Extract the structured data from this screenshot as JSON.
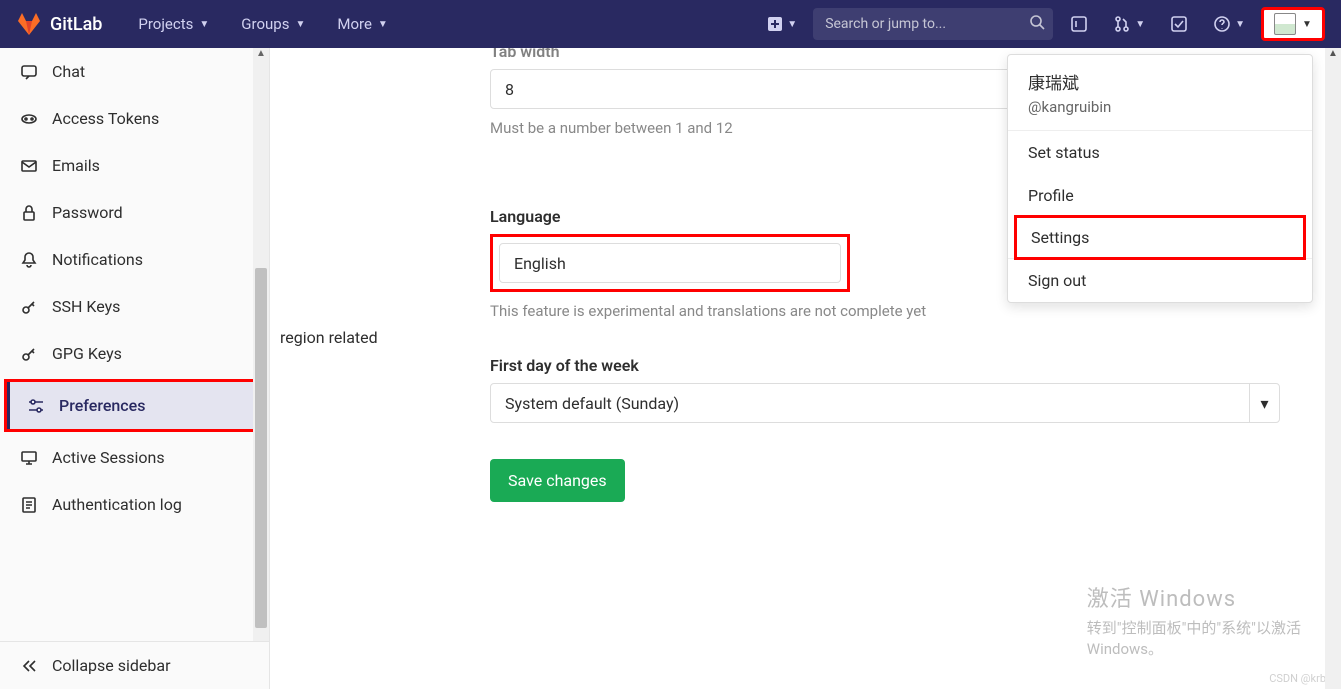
{
  "header": {
    "brand": "GitLab",
    "nav": {
      "projects": "Projects",
      "groups": "Groups",
      "more": "More"
    },
    "search_placeholder": "Search or jump to..."
  },
  "sidebar": {
    "items": [
      {
        "label": "Chat"
      },
      {
        "label": "Access Tokens"
      },
      {
        "label": "Emails"
      },
      {
        "label": "Password"
      },
      {
        "label": "Notifications"
      },
      {
        "label": "SSH Keys"
      },
      {
        "label": "GPG Keys"
      },
      {
        "label": "Preferences"
      },
      {
        "label": "Active Sessions"
      },
      {
        "label": "Authentication log"
      }
    ],
    "collapse": "Collapse sidebar"
  },
  "form": {
    "region_label": "region related",
    "tab_width": {
      "label": "Tab width",
      "value": "8",
      "hint": "Must be a number between 1 and 12"
    },
    "language": {
      "label": "Language",
      "value": "English",
      "hint": "This feature is experimental and translations are not complete yet"
    },
    "first_day": {
      "label": "First day of the week",
      "value": "System default (Sunday)"
    },
    "save": "Save changes"
  },
  "user_menu": {
    "display_name": "康瑞斌",
    "username": "@kangruibin",
    "set_status": "Set status",
    "profile": "Profile",
    "settings": "Settings",
    "sign_out": "Sign out"
  },
  "watermark": {
    "title": "激活 Windows",
    "sub": "转到\"控制面板\"中的\"系统\"以激活",
    "sub2": "Windows。"
  },
  "csdn": "CSDN @krb_"
}
